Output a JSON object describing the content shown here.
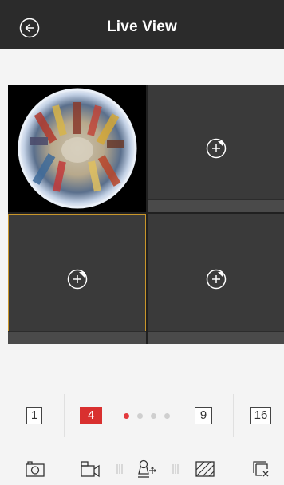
{
  "header": {
    "title": "Live View",
    "back_icon": "back-arrow-icon"
  },
  "grid": {
    "tiles": [
      {
        "state": "live-fisheye-video"
      },
      {
        "state": "empty",
        "icon": "add-camera-icon"
      },
      {
        "state": "empty",
        "icon": "add-camera-icon",
        "selected": true
      },
      {
        "state": "empty",
        "icon": "add-camera-icon"
      }
    ]
  },
  "layout": {
    "options": [
      "1",
      "4",
      "9",
      "16"
    ],
    "selected": "4",
    "page_count": 4,
    "current_page": 1
  },
  "toolbar": {
    "icons": [
      "capture-icon",
      "record-icon",
      "ptz-icon",
      "image-quality-icon",
      "close-all-icon"
    ]
  },
  "colors": {
    "accent": "#d9302f",
    "header_bg": "#2b2b2b",
    "selected_border": "#c9962a"
  }
}
